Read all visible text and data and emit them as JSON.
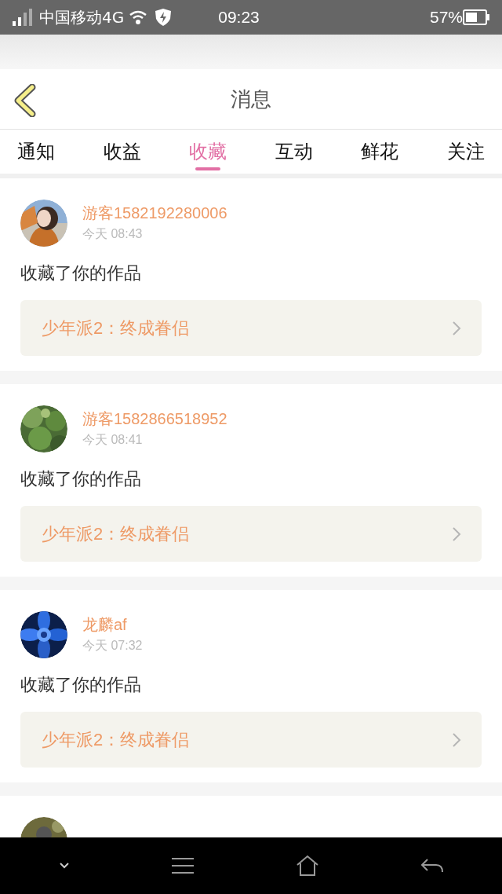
{
  "status_bar": {
    "carrier": "中国移动4G",
    "time": "09:23",
    "battery": "57%"
  },
  "header": {
    "title": "消息"
  },
  "tabs": [
    {
      "label": "通知",
      "selected": false
    },
    {
      "label": "收益",
      "selected": false
    },
    {
      "label": "收藏",
      "selected": true
    },
    {
      "label": "互动",
      "selected": false
    },
    {
      "label": "鲜花",
      "selected": false
    },
    {
      "label": "关注",
      "selected": false
    }
  ],
  "messages": [
    {
      "kind": "full",
      "user": "游客1582192280006",
      "time": "今天 08:43",
      "action": "收藏了你的作品",
      "work": "少年派2：终成眷侣"
    },
    {
      "kind": "full",
      "user": "游客1582866518952",
      "time": "今天 08:41",
      "action": "收藏了你的作品",
      "work": "少年派2：终成眷侣"
    },
    {
      "kind": "full",
      "user": "龙麟af",
      "time": "今天 07:32",
      "action": "收藏了你的作品",
      "work": "少年派2：终成眷侣"
    },
    {
      "kind": "partial"
    }
  ]
}
